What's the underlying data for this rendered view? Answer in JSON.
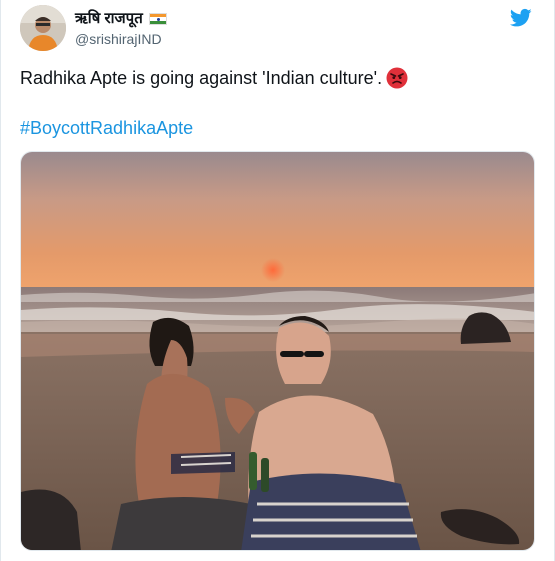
{
  "tweet": {
    "display_name": "ऋषि राजपूत",
    "handle": "@srishirajIND",
    "text": "Radhika Apte is going against 'Indian culture'.",
    "hashtag": "#BoycottRadhikaApte"
  },
  "icons": {
    "avatar": "avatar-photo",
    "flag": "india-flag-icon",
    "brand": "twitter-bird-icon",
    "emoji": "angry-face-emoji"
  },
  "colors": {
    "link": "#1b95e0",
    "brand": "#1da1f2",
    "text": "#0f1419",
    "muted": "#536471"
  }
}
